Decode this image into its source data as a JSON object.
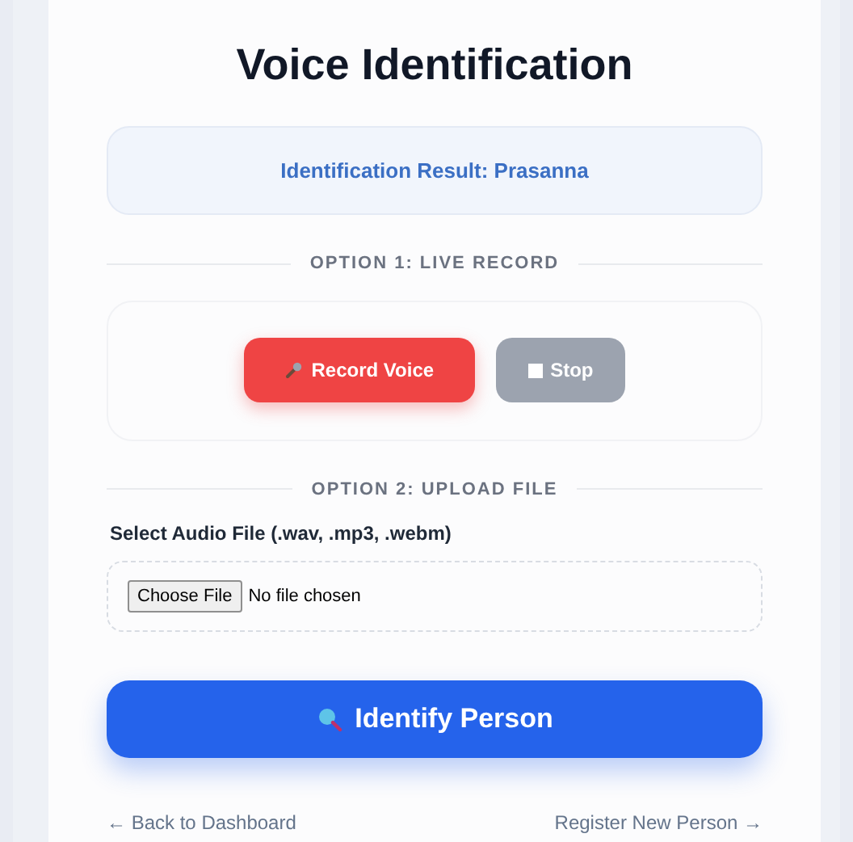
{
  "title": "Voice Identification",
  "result": {
    "label": "Identification Result: Prasanna"
  },
  "sections": [
    {
      "heading": "OPTION 1: LIVE RECORD"
    },
    {
      "heading": "OPTION 2: UPLOAD FILE"
    }
  ],
  "record_buttons": [
    {
      "kind": "record",
      "label": "Record Voice"
    },
    {
      "kind": "stop",
      "label": "Stop"
    }
  ],
  "upload": {
    "label": "Select Audio File (.wav, .mp3, .webm)",
    "button": "Choose File",
    "status": "No file chosen"
  },
  "identify_button": {
    "label": "Identify Person"
  },
  "links": [
    {
      "label": "← Back to Dashboard"
    },
    {
      "label": "Register New Person →"
    }
  ]
}
